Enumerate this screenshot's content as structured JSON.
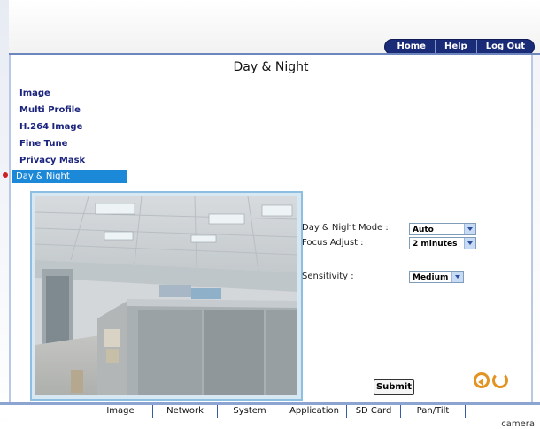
{
  "header": {
    "links": [
      "Home",
      "Help",
      "Log Out"
    ]
  },
  "page": {
    "title": "Day & Night"
  },
  "sidebar": {
    "items": [
      {
        "label": "Image"
      },
      {
        "label": "Multi Profile"
      },
      {
        "label": "H.264 Image"
      },
      {
        "label": "Fine Tune"
      },
      {
        "label": "Privacy Mask"
      },
      {
        "label": "Day & Night",
        "active": true
      }
    ]
  },
  "form": {
    "day_night_mode": {
      "label": "Day & Night Mode :",
      "value": "Auto"
    },
    "focus_adjust": {
      "label": "Focus Adjust :",
      "value": "2 minutes"
    },
    "sensitivity": {
      "label": "Sensitivity :",
      "value": "Medium"
    }
  },
  "actions": {
    "submit_label": "Submit"
  },
  "bottom_nav": {
    "tabs": [
      "Image",
      "Network",
      "System",
      "Application",
      "SD Card",
      "Pan/Tilt"
    ]
  },
  "footer": {
    "label": "camera"
  },
  "colors": {
    "nav_blue": "#1a2b77",
    "active_item": "#1c88d8",
    "icon_orange": "#e39321"
  },
  "icons": {
    "back": "back-arrow-icon",
    "refresh": "refresh-icon",
    "active_marker": "bullet-icon"
  }
}
